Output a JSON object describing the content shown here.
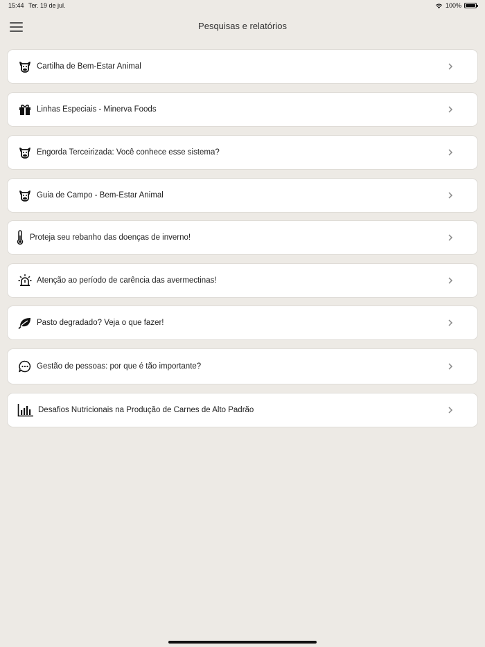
{
  "status": {
    "time": "15:44",
    "date": "Ter. 19 de jul.",
    "battery": "100%"
  },
  "header": {
    "title": "Pesquisas e relatórios"
  },
  "items": [
    {
      "label": "Cartilha de Bem-Estar Animal",
      "icon": "cow-icon"
    },
    {
      "label": "Linhas Especiais - Minerva Foods",
      "icon": "gift-icon"
    },
    {
      "label": "Engorda Terceirizada: Você conhece esse sistema?",
      "icon": "cow-icon"
    },
    {
      "label": "Guia de Campo - Bem-Estar Animal",
      "icon": "cow-icon"
    },
    {
      "label": "Proteja seu rebanho das doenças de inverno!",
      "icon": "thermometer-icon"
    },
    {
      "label": "Atenção ao período de carência das avermectinas!",
      "icon": "alarm-light-icon"
    },
    {
      "label": "Pasto degradado? Veja o que fazer!",
      "icon": "leaf-icon"
    },
    {
      "label": "Gestão de pessoas: por que é tão importante?",
      "icon": "chat-bubble-icon"
    },
    {
      "label": "Desafios Nutricionais na Produção de Carnes de Alto Padrão",
      "icon": "bar-chart-icon"
    }
  ],
  "colors": {
    "background": "#edeae5",
    "card": "#ffffff",
    "chevron": "#888888"
  }
}
